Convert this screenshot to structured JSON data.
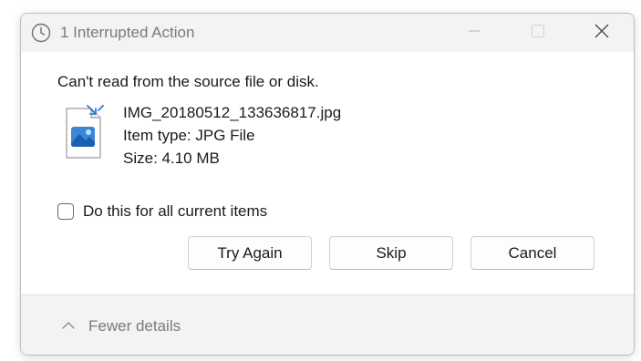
{
  "window": {
    "title": "1 Interrupted Action",
    "title_icon": "clock-icon",
    "controls": [
      "minimize-icon",
      "maximize-icon",
      "close-icon"
    ]
  },
  "content": {
    "message": "Can't read from the source file or disk.",
    "file": {
      "name": "IMG_20180512_133636817.jpg",
      "type_line": "Item type: JPG File",
      "size_line": "Size: 4.10 MB",
      "icon": "image-file-icon"
    },
    "checkbox": {
      "label": "Do this for all current items",
      "checked": false
    }
  },
  "buttons": {
    "try_again": "Try Again",
    "skip": "Skip",
    "cancel": "Cancel"
  },
  "footer": {
    "label": "Fewer details",
    "icon": "chevron-up-icon"
  },
  "colors": {
    "titlebar_bg": "#f3f3f3",
    "footer_bg": "#f3f3f3",
    "accent_blue": "#2b7bd3",
    "muted_text": "#7a7a7a"
  }
}
